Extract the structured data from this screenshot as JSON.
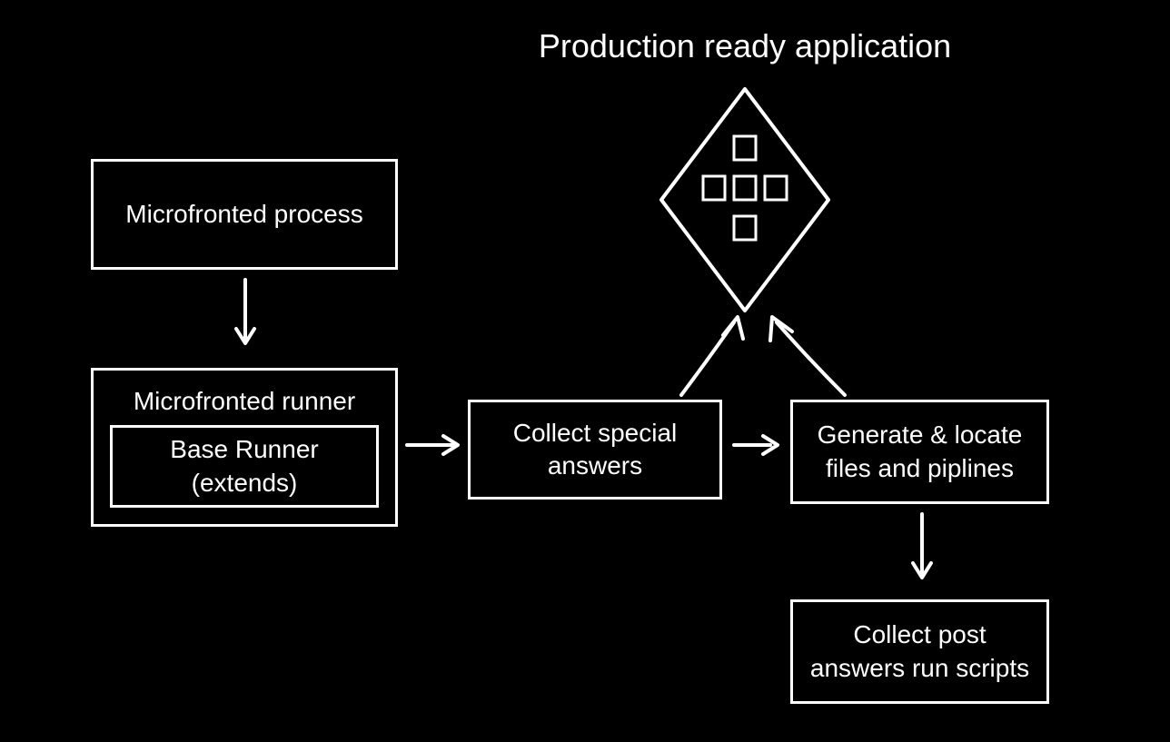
{
  "title": "Production ready application",
  "nodes": {
    "microfrontend_process": "Microfronted process",
    "microfrontend_runner": "Microfronted runner",
    "base_runner": "Base Runner (extends)",
    "collect_special": "Collect special answers",
    "generate_locate": "Generate & locate files and piplines",
    "collect_post": "Collect post answers run scripts"
  }
}
